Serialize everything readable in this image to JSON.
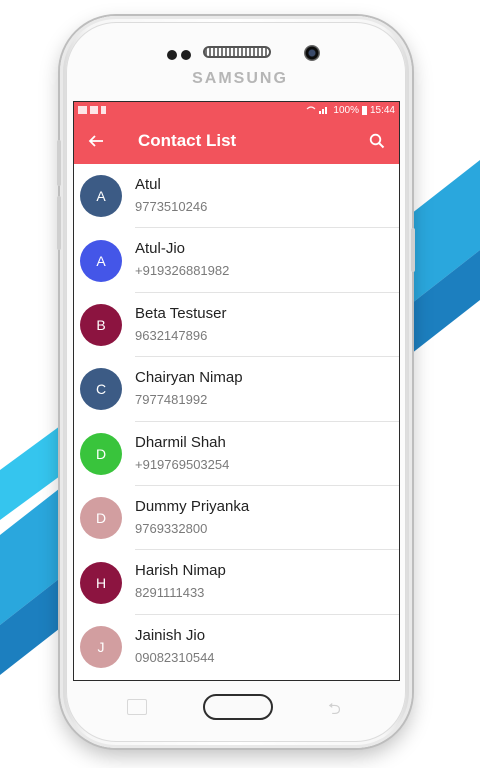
{
  "statusbar": {
    "battery": "100%",
    "time": "15:44"
  },
  "device": {
    "brand": "SAMSUNG"
  },
  "toolbar": {
    "title": "Contact List",
    "back_icon": "arrow-left-icon",
    "search_icon": "search-icon",
    "background": "#f2535c"
  },
  "contacts": [
    {
      "initial": "A",
      "name": "Atul",
      "phone": "9773510246",
      "color": "#3c5b85"
    },
    {
      "initial": "A",
      "name": "Atul-Jio",
      "phone": "+919326881982",
      "color": "#4456e8"
    },
    {
      "initial": "B",
      "name": "Beta Testuser",
      "phone": "9632147896",
      "color": "#8c1440"
    },
    {
      "initial": "C",
      "name": "Chairyan Nimap",
      "phone": "7977481992",
      "color": "#3c5b85"
    },
    {
      "initial": "D",
      "name": "Dharmil Shah",
      "phone": "+919769503254",
      "color": "#39c43c"
    },
    {
      "initial": "D",
      "name": "Dummy Priyanka",
      "phone": "9769332800",
      "color": "#d29ea0"
    },
    {
      "initial": "H",
      "name": "Harish Nimap",
      "phone": "8291111433",
      "color": "#8c1440"
    },
    {
      "initial": "J",
      "name": "Jainish Jio",
      "phone": "09082310544",
      "color": "#d29ea0"
    }
  ]
}
